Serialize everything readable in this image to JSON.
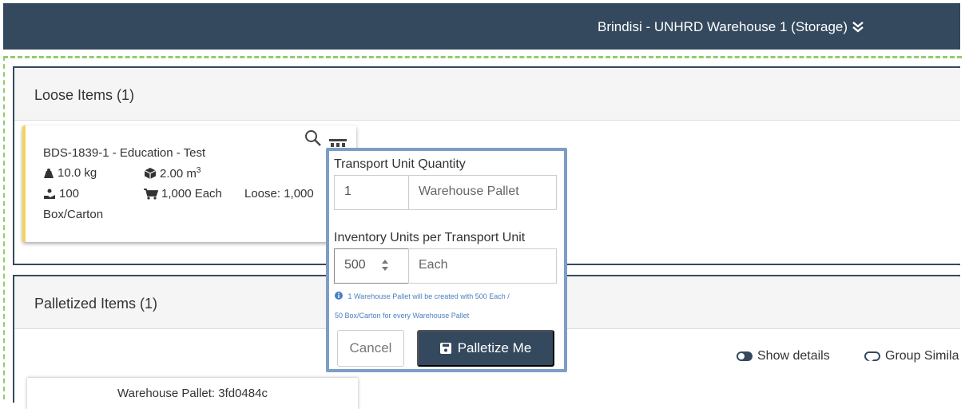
{
  "header": {
    "warehouse": "Brindisi - UNHRD Warehouse 1 (Storage)"
  },
  "loose": {
    "title": "Loose Items (1)",
    "item": {
      "name": "BDS-1839-1 - Education - Test",
      "weight": "10.0 kg",
      "volume": "2.00 m",
      "volume_exp": "3",
      "units": "100",
      "quantity": "1,000 Each",
      "loose": "Loose: 1,000",
      "package": "Box/Carton"
    }
  },
  "palletized": {
    "title": "Palletized Items (1)",
    "pallet_label": "Warehouse Pallet: 3fd0484c",
    "show_details": "Show details",
    "group_similar": "Group Simila"
  },
  "popup": {
    "tu_qty_label": "Transport Unit Quantity",
    "tu_qty_value": "1",
    "tu_type": "Warehouse Pallet",
    "inv_label": "Inventory Units per Transport Unit",
    "inv_value": "500",
    "inv_unit": "Each",
    "help_line1": "1 Warehouse Pallet will be created with 500 Each /",
    "help_line2": "50 Box/Carton for every Warehouse Pallet",
    "cancel": "Cancel",
    "palletize": "Palletize Me"
  },
  "colors": {
    "header_bg": "#34495e",
    "accent_yellow": "#f4d35e",
    "popup_border": "#7d9dc7",
    "dropzone": "#8fce6b"
  }
}
